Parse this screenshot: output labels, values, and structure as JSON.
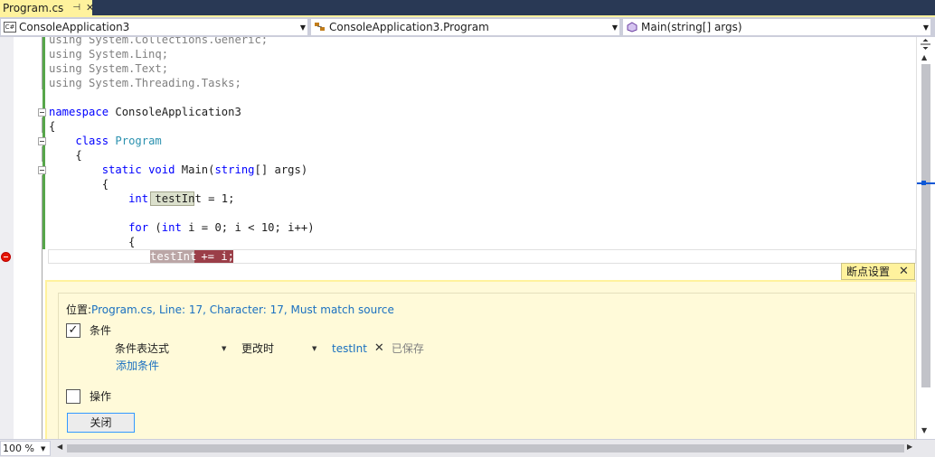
{
  "tab": {
    "title": "Program.cs",
    "pin_glyph": "⊣",
    "close_glyph": "✕"
  },
  "navbar": {
    "project": "ConsoleApplication3",
    "type": "ConsoleApplication3.Program",
    "member": "Main(string[] args)"
  },
  "code": {
    "line1": {
      "kw": "using",
      "rest": " System.Collections.Generic;"
    },
    "line2": {
      "kw": "using",
      "rest": " System.Linq;"
    },
    "line3": {
      "kw": "using",
      "rest": " System.Text;"
    },
    "line4": {
      "kw": "using",
      "rest": " System.Threading.Tasks;"
    },
    "line6": {
      "kw": "namespace",
      "rest": " ConsoleApplication3"
    },
    "line7": {
      "text": "{"
    },
    "line8": {
      "indent": "    ",
      "kw": "class",
      "space": " ",
      "type": "Program"
    },
    "line9": {
      "text": "    {"
    },
    "line10": {
      "indent": "        ",
      "kw1": "static",
      "space1": " ",
      "kw2": "void",
      "mid": " Main(",
      "kw3": "string",
      "rest": "[] args)"
    },
    "line11": {
      "text": "        {"
    },
    "line12": {
      "indent": "            ",
      "kw": "int",
      "space": " ",
      "ident": "testInt",
      "rest": " = 1;"
    },
    "line14": {
      "indent": "            ",
      "kw1": "for",
      "mid1": " (",
      "kw2": "int",
      "rest": " i = 0; i < 10; i++)"
    },
    "line15": {
      "text": "            {"
    },
    "line16": {
      "ident": "testInt",
      "rest": " += i;"
    }
  },
  "breakpoint_settings": {
    "title": "断点设置",
    "close_glyph": "✕",
    "location_label": "位置: ",
    "location_value": "Program.cs, Line: 17, Character: 17, Must match source",
    "conditions_label": "条件",
    "conditions_checked": true,
    "condition_kind": "条件表达式",
    "condition_when": "更改时",
    "condition_value": "testInt",
    "remove_glyph": "✕",
    "saved_label": "已保存",
    "add_condition": "添加条件",
    "actions_label": "操作",
    "actions_checked": false,
    "close_button": "关闭"
  },
  "statusbar": {
    "zoom": "100 %"
  },
  "colors": {
    "keyword": "#0000ff",
    "type": "#2b91af",
    "link": "#1a70c0",
    "breakpoint": "#e51400",
    "peek_background": "#fffad9",
    "peek_accent": "#fff29d",
    "change_bar": "#57a64a"
  },
  "icons": {
    "checkmark": "✓",
    "dropdown": "▼",
    "scroll_up": "▲",
    "scroll_down": "▼",
    "scroll_left": "◀",
    "scroll_right": "▶"
  }
}
